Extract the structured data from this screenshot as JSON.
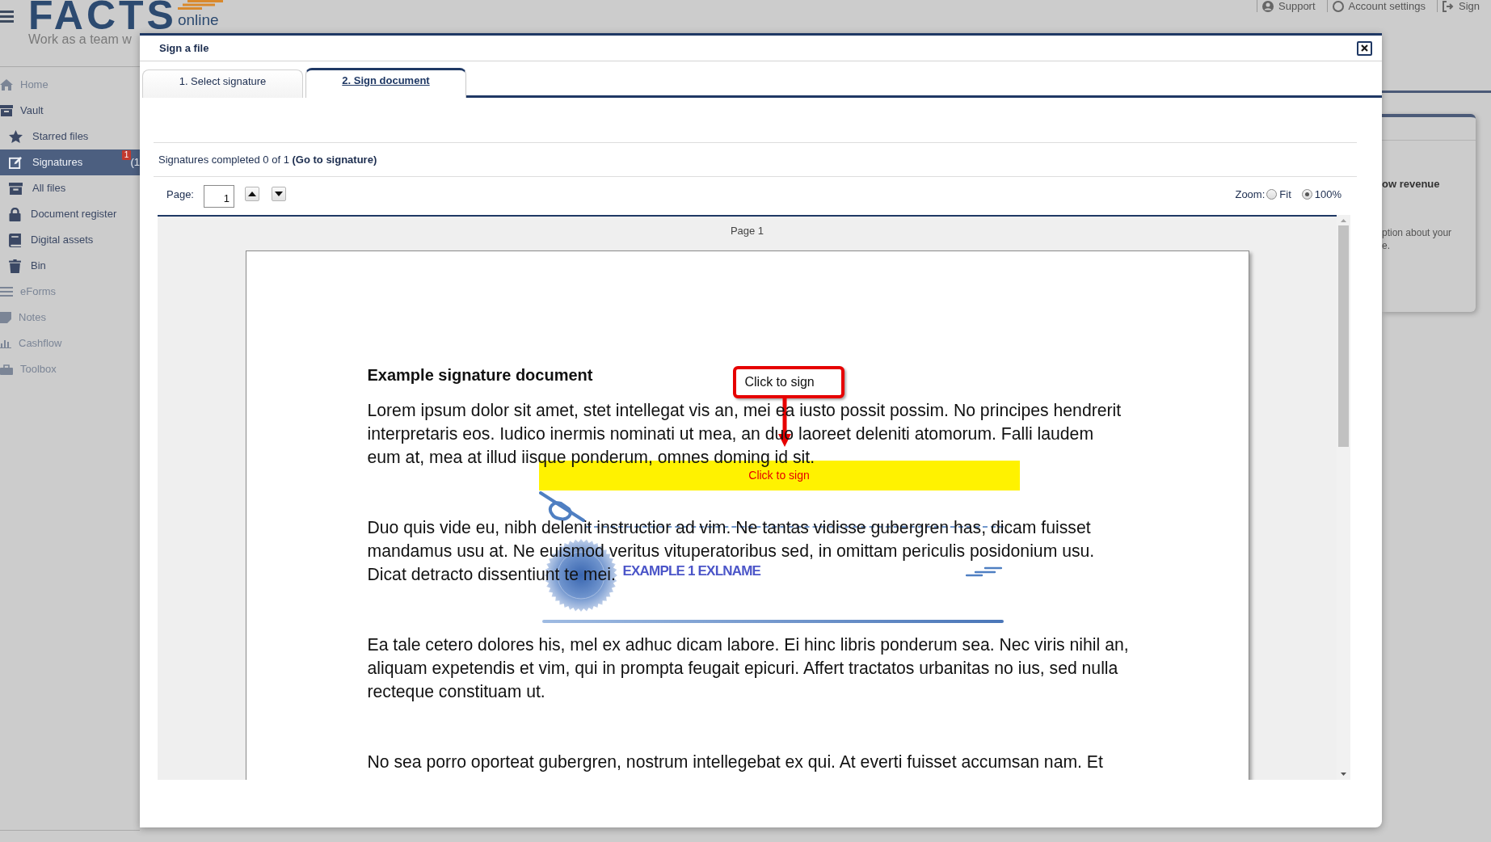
{
  "header": {
    "logo": {
      "wordmark": "FACTS",
      "suffix": "online",
      "tagline": "Work as a team w"
    },
    "links": [
      {
        "label": "Support"
      },
      {
        "label": "Account settings"
      },
      {
        "label": "Sign"
      }
    ]
  },
  "sidebar": {
    "items": [
      {
        "label": "Home",
        "expanded": false,
        "selected": false
      },
      {
        "label": "Vault",
        "expanded": true,
        "selected": false,
        "children": [
          {
            "label": "Starred files",
            "selected": false
          },
          {
            "label": "Signatures",
            "selected": true,
            "badge": "1",
            "count": "(1"
          },
          {
            "label": "All files",
            "selected": false
          },
          {
            "label": "Document register",
            "selected": false
          },
          {
            "label": "Digital assets",
            "selected": false
          },
          {
            "label": "Bin",
            "selected": false
          }
        ]
      },
      {
        "label": "eForms",
        "expanded": false,
        "selected": false
      },
      {
        "label": "Notes",
        "expanded": false,
        "selected": false
      },
      {
        "label": "Cashflow",
        "expanded": false,
        "selected": false
      },
      {
        "label": "Toolbox",
        "expanded": false,
        "selected": false
      }
    ]
  },
  "background_card": {
    "title": "ow revenue",
    "lines": [
      "ption about your",
      "e."
    ]
  },
  "dialog": {
    "title": "Sign a file",
    "tabs": [
      {
        "label": "1. Select signature",
        "selected": false
      },
      {
        "label": "2. Sign document",
        "selected": true
      }
    ],
    "status": {
      "text": "Signatures completed 0 of 1",
      "link": "(Go to signature)"
    },
    "pager": {
      "label": "Page:",
      "value": "1"
    },
    "zoom": {
      "label": "Zoom:",
      "options": [
        {
          "label": "Fit",
          "selected": false
        },
        {
          "label": "100%",
          "selected": true
        }
      ]
    },
    "viewer": {
      "page_label": "Page 1",
      "document": {
        "heading": "Example signature document",
        "paragraphs": [
          {
            "lines": [
              "Lorem ipsum dolor sit amet, stet intellegat vis an, mei ea iusto possit possim. No principes hendrerit",
              "interpretaris eos. Iudico inermis nominati ut mea, an duo laoreet deleniti atomorum. Falli laudem",
              "eum at, mea at illud iisque ponderum, omnes doming id sit."
            ]
          },
          {
            "lines": [
              "Duo quis vide eu, nibh delenit instructior ad vim. Ne tantas vidisse gubergren has, dicam fuisset",
              "mandamus usu at. Ne euismod veritus vituperatoribus sed, in omittam periculis posidonium usu.",
              "Dicat detracto dissentiunt te mei."
            ]
          },
          {
            "lines": [
              "Ea tale cetero dolores his, mel ex adhuc dicam labore. Ei hinc libris ponderum sea. Nec viris nihil an,",
              "aliquam expetendis et vim, qui in prompta feugait epicuri. Affert tractatos urbanitas no ius, sed nulla",
              "recteque constituam ut."
            ]
          },
          {
            "lines": [
              "No sea porro oporteat gubergren, nostrum intellegebat ex qui. At everti fuisset accumsan nam. Et"
            ]
          }
        ]
      },
      "callout": {
        "label": "Click to sign"
      },
      "sign_field": {
        "label": "Click to sign"
      },
      "signature": {
        "name": "EXAMPLE 1 EXLNAME"
      }
    }
  }
}
